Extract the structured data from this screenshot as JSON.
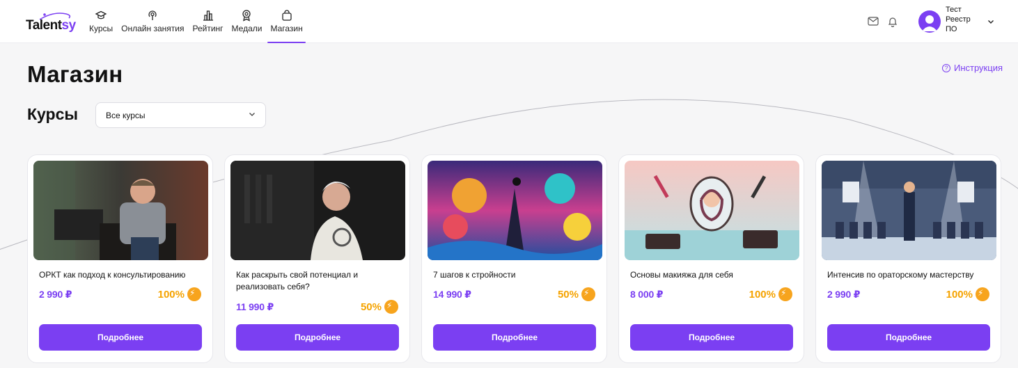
{
  "header": {
    "logo_text_main": "Talent",
    "logo_text_accent": "sy",
    "nav": [
      {
        "label": "Курсы",
        "icon": "graduation-cap-icon",
        "active": false
      },
      {
        "label": "Онлайн занятия",
        "icon": "broadcast-icon",
        "active": false
      },
      {
        "label": "Рейтинг",
        "icon": "bar-chart-icon",
        "active": false
      },
      {
        "label": "Медали",
        "icon": "medal-icon",
        "active": false
      },
      {
        "label": "Магазин",
        "icon": "shopping-bag-icon",
        "active": true
      }
    ],
    "user_name": "Тест Реестр ПО"
  },
  "page": {
    "title": "Магазин",
    "instruction_label": "Инструкция",
    "section_title": "Курсы",
    "filter_value": "Все курсы"
  },
  "cards": [
    {
      "title": "ОРКТ как подход к консультированию",
      "price": "2 990 ₽",
      "discount": "100%",
      "button": "Подробнее"
    },
    {
      "title": "Как раскрыть свой потенциал и реализовать себя?",
      "price": "11 990 ₽",
      "discount": "50%",
      "button": "Подробнее"
    },
    {
      "title": "7 шагов к стройности",
      "price": "14 990 ₽",
      "discount": "50%",
      "button": "Подробнее"
    },
    {
      "title": "Основы макияжа для себя",
      "price": "8 000 ₽",
      "discount": "100%",
      "button": "Подробнее"
    },
    {
      "title": "Интенсив по ораторскому мастерству",
      "price": "2 990 ₽",
      "discount": "100%",
      "button": "Подробнее"
    }
  ],
  "colors": {
    "accent": "#7b3ff2",
    "discount": "#f5a300",
    "background": "#f6f6f7"
  }
}
